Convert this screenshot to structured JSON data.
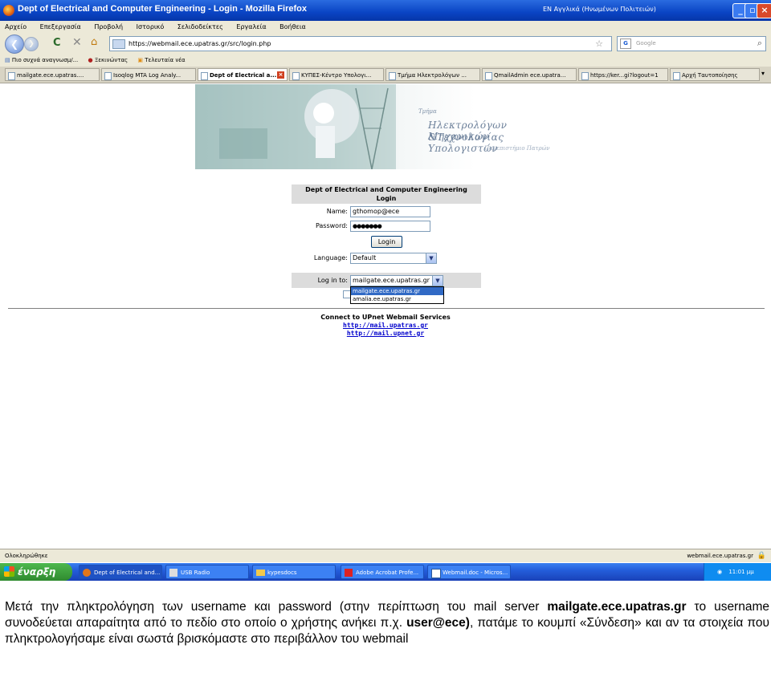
{
  "window": {
    "title": "Dept of Electrical and Computer Engineering - Login - Mozilla Firefox",
    "lang_indicator": "EN Αγγλικά (Ηνωμένων Πολιτειών)"
  },
  "menu": [
    "Αρχείο",
    "Επεξεργασία",
    "Προβολή",
    "Ιστορικό",
    "Σελιδοδείκτες",
    "Εργαλεία",
    "Βοήθεια"
  ],
  "nav": {
    "url": "https://webmail.ece.upatras.gr/src/login.php",
    "search_placeholder": "Google"
  },
  "bookmarks": [
    "Πιο συχνά αναγνωσμ/...",
    "Ξεκινώντας",
    "Τελευταία νέα"
  ],
  "tabs": [
    {
      "label": "mailgate.ece.upatras....",
      "active": false
    },
    {
      "label": "Isoqlog MTA Log Analy...",
      "active": false
    },
    {
      "label": "Dept of Electrical a...",
      "active": true
    },
    {
      "label": "ΚΥΠΕΣ-Κέντρο Υπολογι...",
      "active": false
    },
    {
      "label": "Τμήμα Ηλεκτρολόγων ...",
      "active": false
    },
    {
      "label": "QmailAdmin ece.upatra...",
      "active": false
    },
    {
      "label": "https://ker...gi?logout=1",
      "active": false
    },
    {
      "label": "Αρχή Ταυτοποίησης",
      "active": false
    }
  ],
  "banner": {
    "line1": "Τμήμα",
    "line2": "Ηλεκτρολόγων Μηχανικών",
    "line3": "&Τεχνολογίας Υπολογιστών",
    "line4": "Πανεπιστήμιο Πατρών"
  },
  "login": {
    "header1": "Dept of Electrical and Computer Engineering",
    "header2": "Login",
    "name_label": "Name:",
    "name_value": "gthomop@ece",
    "password_label": "Password:",
    "password_value": "●●●●●●●",
    "button": "Login",
    "language_label": "Language:",
    "language_value": "Default",
    "login_to_label": "Log in to:",
    "login_to_value": "mailgate.ece.upatras.gr",
    "options": [
      "mailgate.ece.upatras.gr",
      "amalia.ee.upatras.gr"
    ]
  },
  "connect": {
    "title": "Connect to UPnet Webmail Services",
    "link1": "http://mail.upatras.gr",
    "link2": "http://mail.upnet.gr"
  },
  "status": {
    "left": "Ολοκληρώθηκε",
    "right": "webmail.ece.upatras.gr"
  },
  "taskbar": {
    "start": "έναρξη",
    "tasks": [
      "Dept of Electrical and...",
      "USB Radio",
      "kypesdocs",
      "Adobe Acrobat Profe...",
      "Webmail.doc - Micros..."
    ],
    "clock": "11:01 μμ"
  },
  "caption": {
    "p1": "Μετά την πληκτρολόγηση των username και password (στην περίπτωση του mail server ",
    "b1": "mailgate.ece.upatras.gr",
    "p2": " το username συνοδεύεται απαραίτητα από το πεδίο στο οποίο ο χρήστης ανήκει π.χ. ",
    "b2": "user@ece)",
    "p3": ", πατάμε το κουμπί «Σύνδεση» και αν τα στοιχεία που πληκτρολογήσαμε είναι σωστά βρισκόμαστε στο περιβάλλον του webmail"
  }
}
